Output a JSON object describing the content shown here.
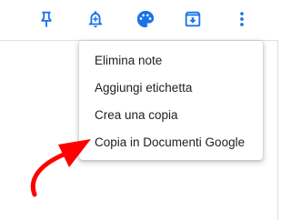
{
  "toolbar": {
    "icons": [
      "pin-icon",
      "reminder-bell-icon",
      "palette-icon",
      "archive-icon",
      "more-vert-icon"
    ],
    "icon_color": "#1a73e8"
  },
  "menu": {
    "items": [
      {
        "label": "Elimina note"
      },
      {
        "label": "Aggiungi etichetta"
      },
      {
        "label": "Crea una copia"
      },
      {
        "label": "Copia in Documenti Google"
      }
    ]
  },
  "annotation": {
    "arrow_color": "#ff0000"
  }
}
